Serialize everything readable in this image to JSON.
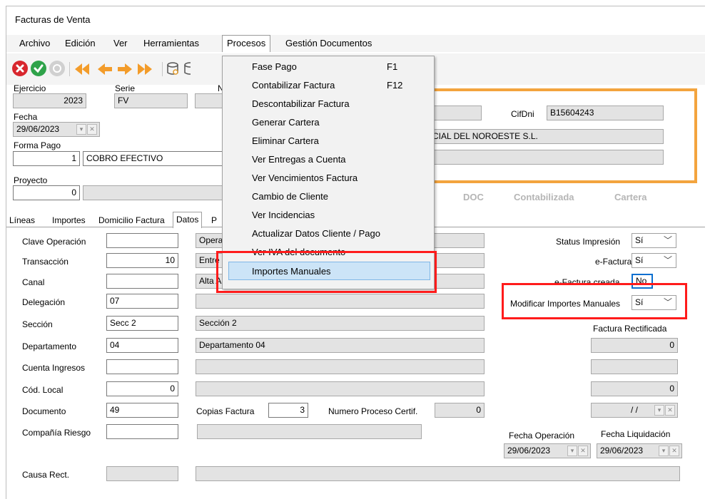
{
  "window": {
    "title": "Facturas de Venta"
  },
  "menu": {
    "archivo": "Archivo",
    "edicion": "Edición",
    "ver": "Ver",
    "herramientas": "Herramientas",
    "procesos": "Procesos",
    "gestion": "Gestión Documentos"
  },
  "colors": {
    "accent_orange": "#f3a43e",
    "highlight_red": "#ff1b1b",
    "cancel_red": "#d8272e",
    "ok_green": "#2fa34a",
    "arrow_orange": "#f39c2a"
  },
  "toolbar": {
    "icons": [
      "cancel-icon",
      "ok-icon",
      "refresh-icon",
      "first-arrow-icon",
      "prev-arrow-icon",
      "next-arrow-icon",
      "last-arrow-icon",
      "search-db-icon",
      "database-icon"
    ]
  },
  "header": {
    "ejercicio_label": "Ejercicio",
    "ejercicio": "2023",
    "serie_label": "Serie",
    "serie": "FV",
    "n_label": "N",
    "fecha_label": "Fecha",
    "fecha": "29/06/2023",
    "forma_pago_label": "Forma Pago",
    "forma_pago_num": "1",
    "forma_pago_desc": "COBRO EFECTIVO",
    "proyecto_label": "Proyecto",
    "proyecto_num": "0"
  },
  "cliente": {
    "cifdni_label": "CifDni",
    "cifdni": "B15604243",
    "nombre": "CIAL DEL NOROESTE S.L."
  },
  "status": {
    "doc": "DOC",
    "contabilizada": "Contabilizada",
    "cartera": "Cartera"
  },
  "tabs": [
    "Líneas",
    "Importes",
    "Domicilio Factura",
    "Datos",
    "P"
  ],
  "procesos_menu": [
    {
      "label": "Fase Pago",
      "shortcut": "F1"
    },
    {
      "label": "Contabilizar Factura",
      "shortcut": "F12"
    },
    {
      "label": "Descontabilizar Factura",
      "shortcut": ""
    },
    {
      "label": "Generar Cartera",
      "shortcut": ""
    },
    {
      "label": "Eliminar Cartera",
      "shortcut": ""
    },
    {
      "label": "Ver Entregas a Cuenta",
      "shortcut": ""
    },
    {
      "label": "Ver Vencimientos Factura",
      "shortcut": ""
    },
    {
      "label": "Cambio de Cliente",
      "shortcut": ""
    },
    {
      "label": "Ver Incidencias",
      "shortcut": ""
    },
    {
      "label": "Actualizar Datos Cliente / Pago",
      "shortcut": ""
    },
    {
      "label": "Ver IVA del documento",
      "shortcut": ""
    },
    {
      "label": "Importes Manuales",
      "shortcut": ""
    }
  ],
  "datos": {
    "clave_operacion_label": "Clave Operación",
    "clave_operacion": "",
    "clave_operacion_desc": "Opera",
    "transaccion_label": "Transacción",
    "transaccion": "10",
    "transaccion_desc": "Entre",
    "canal_label": "Canal",
    "canal": "",
    "canal_desc": "Alta A",
    "delegacion_label": "Delegación",
    "delegacion": "07",
    "seccion_label": "Sección",
    "seccion": "Secc 2",
    "seccion_desc": "Sección 2",
    "departamento_label": "Departamento",
    "departamento": "04",
    "departamento_desc": "Departamento 04",
    "cuenta_ingresos_label": "Cuenta Ingresos",
    "cuenta_ingresos": "",
    "cod_local_label": "Cód. Local",
    "cod_local": "0",
    "documento_label": "Documento",
    "documento": "49",
    "copias_label": "Copias Factura",
    "copias": "3",
    "proceso_certif_label": "Numero Proceso Certif.",
    "proceso_certif": "0",
    "compania_riesgo_label": "Compañía Riesgo",
    "compania_riesgo": "",
    "causa_rect_label": "Causa Rect."
  },
  "right_panel": {
    "status_impresion_label": "Status Impresión",
    "status_impresion": "Sí",
    "efactura_label": "e-Factura",
    "efactura": "Sí",
    "efactura_creada_label": "e-Factura creada",
    "efactura_creada": "No",
    "modificar_importes_label": "Modificar Importes Manuales",
    "modificar_importes": "Sí",
    "factura_rectificada_label": "Factura Rectificada",
    "rect_val1": "0",
    "rect_val3": "0",
    "rect_date": "/ /",
    "fecha_operacion_label": "Fecha Operación",
    "fecha_operacion": "29/06/2023",
    "fecha_liquidacion_label": "Fecha Liquidación",
    "fecha_liquidacion": "29/06/2023"
  }
}
